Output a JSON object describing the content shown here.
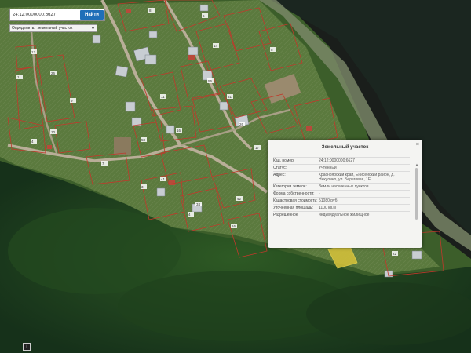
{
  "search": {
    "value": "24:12:0000000:6627",
    "button_label": "Найти"
  },
  "define_select": {
    "label": "Определить:",
    "value": "земельный участок"
  },
  "popup": {
    "title": "Земельный участок",
    "rows": [
      {
        "key": "Кад. номер:",
        "value": "24:12:0000000:6627"
      },
      {
        "key": "Статус:",
        "value": "Учтенный"
      },
      {
        "key": "Адрес:",
        "value": "Красноярский край, Енисейский район, д. Никулино, ул. Береговая, 1Е"
      },
      {
        "key": "Категория земель:",
        "value": "Земли населенных пунктов"
      },
      {
        "key": "Форма собственности:",
        "value": "-"
      },
      {
        "key": "Кадастровая стоимость:",
        "value": "51080 руб."
      },
      {
        "key": "Уточненная площадь:",
        "value": "1100 кв.м"
      },
      {
        "key": "Разрешенное",
        "value": "индивидуальное жилищное"
      }
    ]
  },
  "parcel_labels": [
    "1",
    "26",
    "9",
    "10",
    "4",
    "58",
    "8",
    "6",
    "14",
    "11",
    "56",
    "31",
    "16",
    "26",
    "41",
    "17",
    "42",
    "4",
    "16",
    "34",
    "3",
    "7",
    "13",
    "5",
    "22"
  ],
  "corner_icon": "legend-icon"
}
